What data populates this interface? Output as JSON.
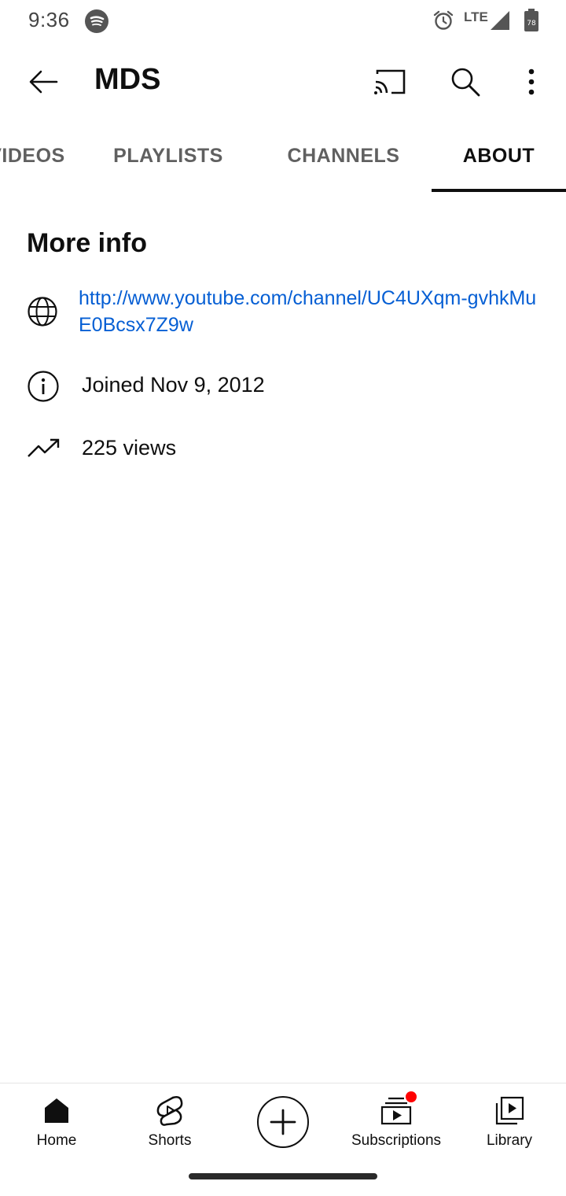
{
  "status_bar": {
    "time": "9:36",
    "network": "LTE",
    "battery_level": "78",
    "icons": [
      "spotify-icon",
      "alarm-icon",
      "signal-icon",
      "battery-icon"
    ]
  },
  "app_bar": {
    "title": "MDS",
    "icons": [
      "back-arrow-icon",
      "cast-icon",
      "search-icon",
      "more-vert-icon"
    ]
  },
  "tabs": [
    {
      "label": "VIDEOS",
      "active": false
    },
    {
      "label": "PLAYLISTS",
      "active": false
    },
    {
      "label": "CHANNELS",
      "active": false
    },
    {
      "label": "ABOUT",
      "active": true
    }
  ],
  "about": {
    "section_title": "More info",
    "link": "http://www.youtube.com/channel/UC4UXqm-gvhkMuE0Bcsx7Z9w",
    "joined": "Joined Nov 9, 2012",
    "views": "225 views"
  },
  "bottom_nav": {
    "items": [
      {
        "label": "Home",
        "icon": "home-icon"
      },
      {
        "label": "Shorts",
        "icon": "shorts-icon"
      },
      {
        "label": "",
        "icon": "create-plus-icon"
      },
      {
        "label": "Subscriptions",
        "icon": "subscriptions-icon",
        "has_notification": true
      },
      {
        "label": "Library",
        "icon": "library-icon"
      }
    ]
  },
  "colors": {
    "link": "#065fd4",
    "text_primary": "#0f0f0f",
    "text_secondary": "#606060",
    "notification": "#ff0000"
  }
}
